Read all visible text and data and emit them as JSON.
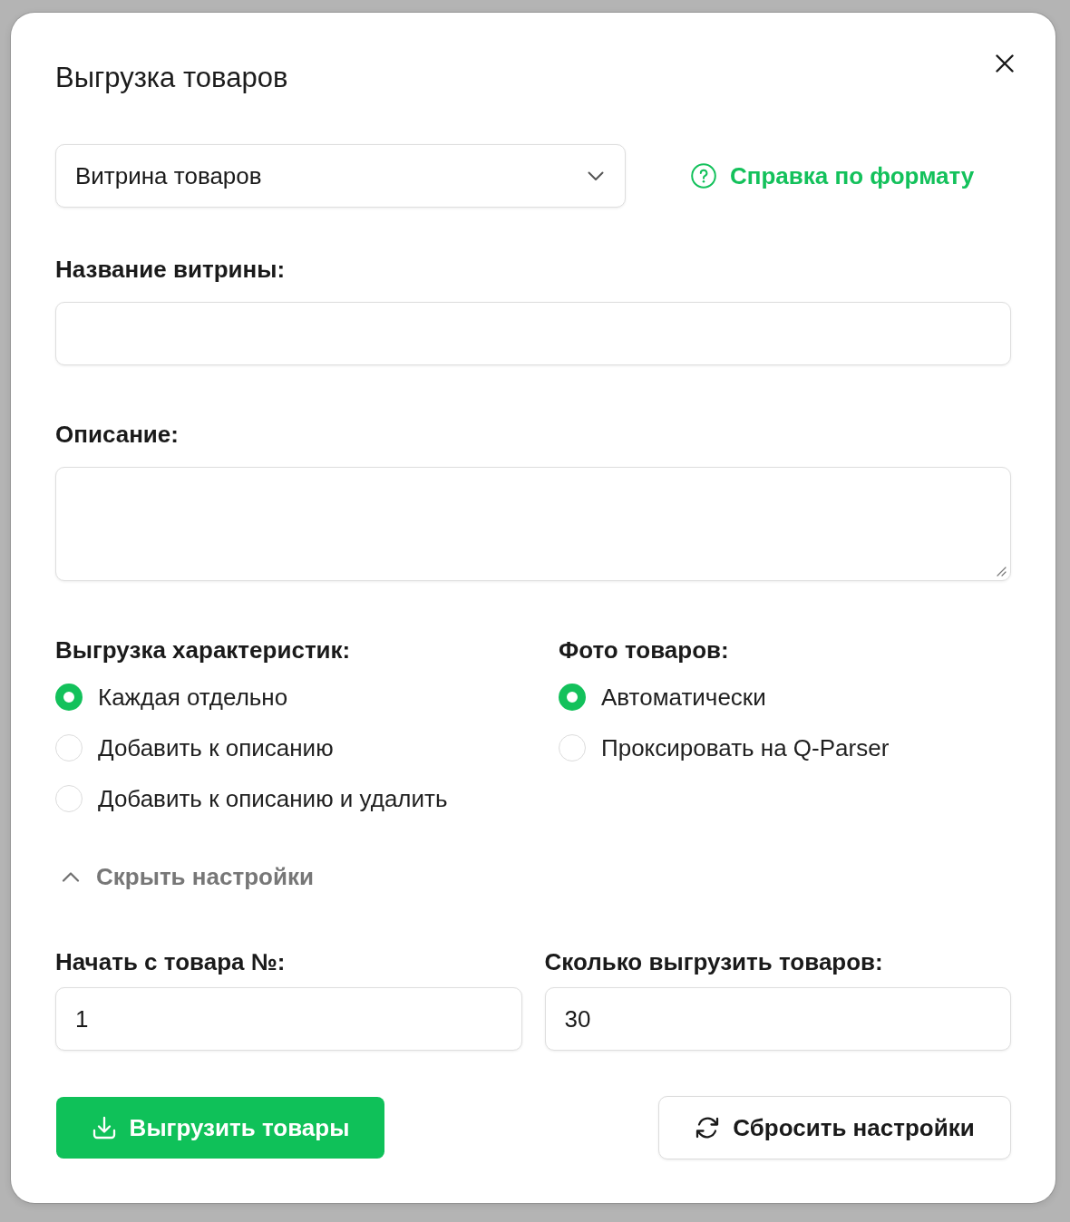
{
  "dialog": {
    "title": "Выгрузка товаров"
  },
  "format_select": {
    "value": "Витрина товаров"
  },
  "help_link": {
    "label": "Справка по формату"
  },
  "fields": [
    {
      "label": "Название витрины:",
      "kind": "input"
    },
    {
      "label": "Описание:",
      "kind": "textarea"
    }
  ],
  "option_groups": [
    {
      "title": "Выгрузка характеристик:",
      "options": [
        {
          "label": "Каждая отдельно",
          "selected": true
        },
        {
          "label": "Добавить к описанию",
          "selected": false
        },
        {
          "label": "Добавить к описанию и удалить",
          "selected": false
        }
      ]
    },
    {
      "title": "Фото товаров:",
      "options": [
        {
          "label": "Автоматически",
          "selected": true
        },
        {
          "label": "Проксировать на Q-Parser",
          "selected": false
        }
      ]
    }
  ],
  "settings_toggle": {
    "label": "Скрыть настройки",
    "expanded": true
  },
  "range_fields": [
    {
      "label": "Начать с товара №:",
      "value": "1"
    },
    {
      "label": "Сколько выгрузить товаров:",
      "value": "30"
    }
  ],
  "buttons": [
    {
      "label": "Выгрузить товары",
      "kind": "primary"
    },
    {
      "label": "Сбросить настройки",
      "kind": "secondary"
    }
  ]
}
